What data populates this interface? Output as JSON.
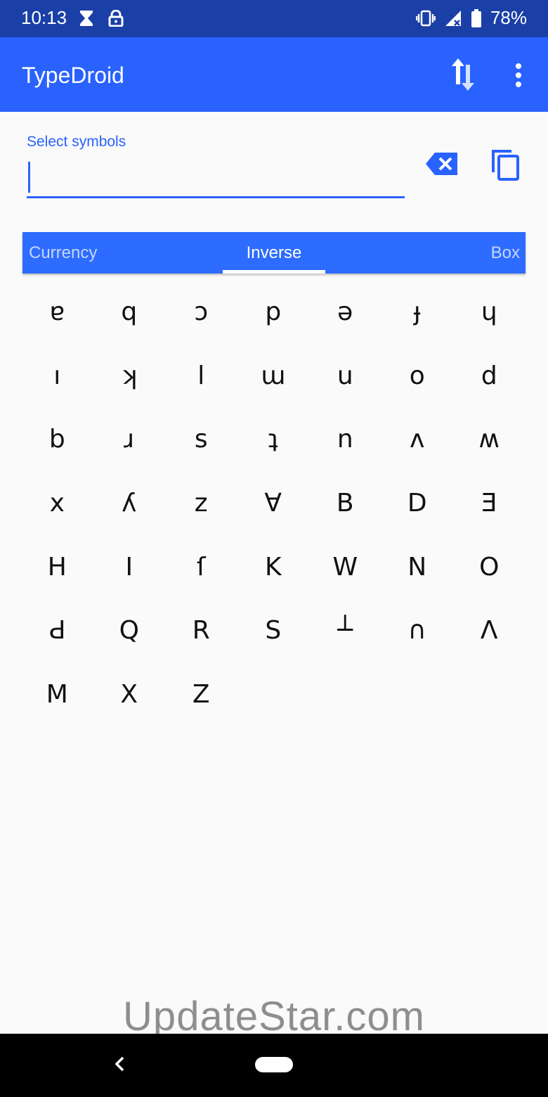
{
  "status_bar": {
    "time": "10:13",
    "battery": "78%",
    "icons": [
      "hourglass-icon",
      "lock-icon",
      "vibrate-icon",
      "signal-icon",
      "battery-icon"
    ]
  },
  "app_bar": {
    "title": "TypeDroid",
    "icons": [
      "swap-vertical-icon",
      "more-vert-icon"
    ]
  },
  "input": {
    "label": "Select symbols",
    "value": ""
  },
  "tabs": [
    {
      "label": "Currency",
      "active": false
    },
    {
      "label": "Inverse",
      "active": true
    },
    {
      "label": "Box",
      "active": false
    }
  ],
  "symbols": [
    "ɐ",
    "q",
    "ɔ",
    "p",
    "ǝ",
    "ɟ",
    "ɥ",
    "ı",
    "ʞ",
    "l",
    "ɯ",
    "u",
    "o",
    "d",
    "b",
    "ɹ",
    "s",
    "ʇ",
    "n",
    "ʌ",
    "ʍ",
    "x",
    "ʎ",
    "z",
    "∀",
    "B",
    "D",
    "Ǝ",
    "H",
    "I",
    "ſ",
    "K",
    "W",
    "N",
    "O",
    "Ԁ",
    "Q",
    "R",
    "S",
    "┴",
    "∩",
    "Λ",
    "M",
    "X",
    "Z"
  ],
  "watermark": "UpdateStar.com",
  "colors": {
    "status_bar": "#1a3fa6",
    "app_bar": "#2962ff",
    "accent": "#2962ff",
    "tab_bar": "#2d6cff"
  }
}
